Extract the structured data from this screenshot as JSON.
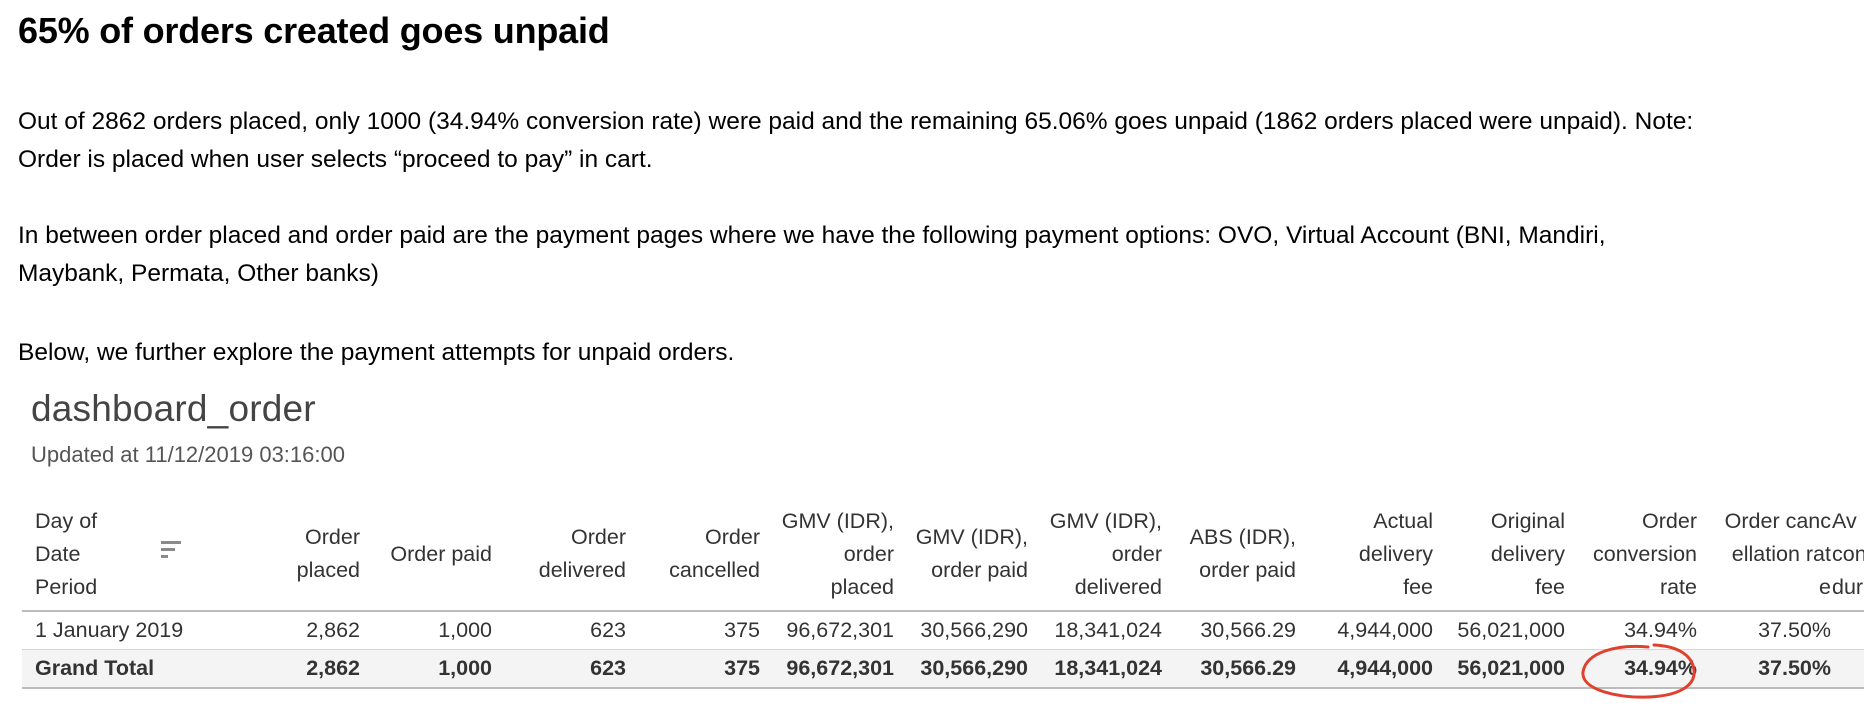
{
  "title": "65% of orders created goes unpaid",
  "paragraphs": [
    {
      "lines": [
        "Out of 2862 orders placed, only 1000 (34.94% conversion rate) were paid and the remaining 65.06% goes unpaid (1862 orders placed were unpaid). Note:",
        "Order is placed when user selects “proceed to pay” in cart."
      ]
    },
    {
      "lines": [
        "In between order placed and order paid are the payment pages where we have the following payment options: OVO, Virtual Account (BNI, Mandiri,",
        "Maybank, Permata, Other banks)"
      ]
    },
    {
      "lines": [
        "Below, we further explore the payment attempts for unpaid orders."
      ]
    }
  ],
  "dashboard": {
    "title": "dashboard_order",
    "updated": "Updated at 11/12/2019 03:16:00",
    "sort_icon": "sort-descending-icon",
    "columns": [
      "Day of\nDate\nPeriod",
      "Order\nplaced",
      "Order paid",
      "Order\ndelivered",
      "Order\ncancelled",
      "GMV (IDR),\norder\nplaced",
      "GMV (IDR),\norder paid",
      "GMV (IDR),\norder\ndelivered",
      "ABS (IDR),\norder paid",
      "Actual\ndelivery\nfee",
      "Original\ndelivery\nfee",
      "Order\nconversion\nrate",
      "Order canc\nellation rat\ne",
      "Av\ncon\ndur"
    ],
    "rows": [
      {
        "cells": [
          "1 January 2019",
          "2,862",
          "1,000",
          "623",
          "375",
          "96,672,301",
          "30,566,290",
          "18,341,024",
          "30,566.29",
          "4,944,000",
          "56,021,000",
          "34.94%",
          "37.50%",
          ""
        ]
      },
      {
        "cells": [
          "Grand Total",
          "2,862",
          "1,000",
          "623",
          "375",
          "96,672,301",
          "30,566,290",
          "18,341,024",
          "30,566.29",
          "4,944,000",
          "56,021,000",
          "34.94%",
          "37.50%",
          ""
        ]
      }
    ],
    "annotation_color": "#e0402e"
  }
}
